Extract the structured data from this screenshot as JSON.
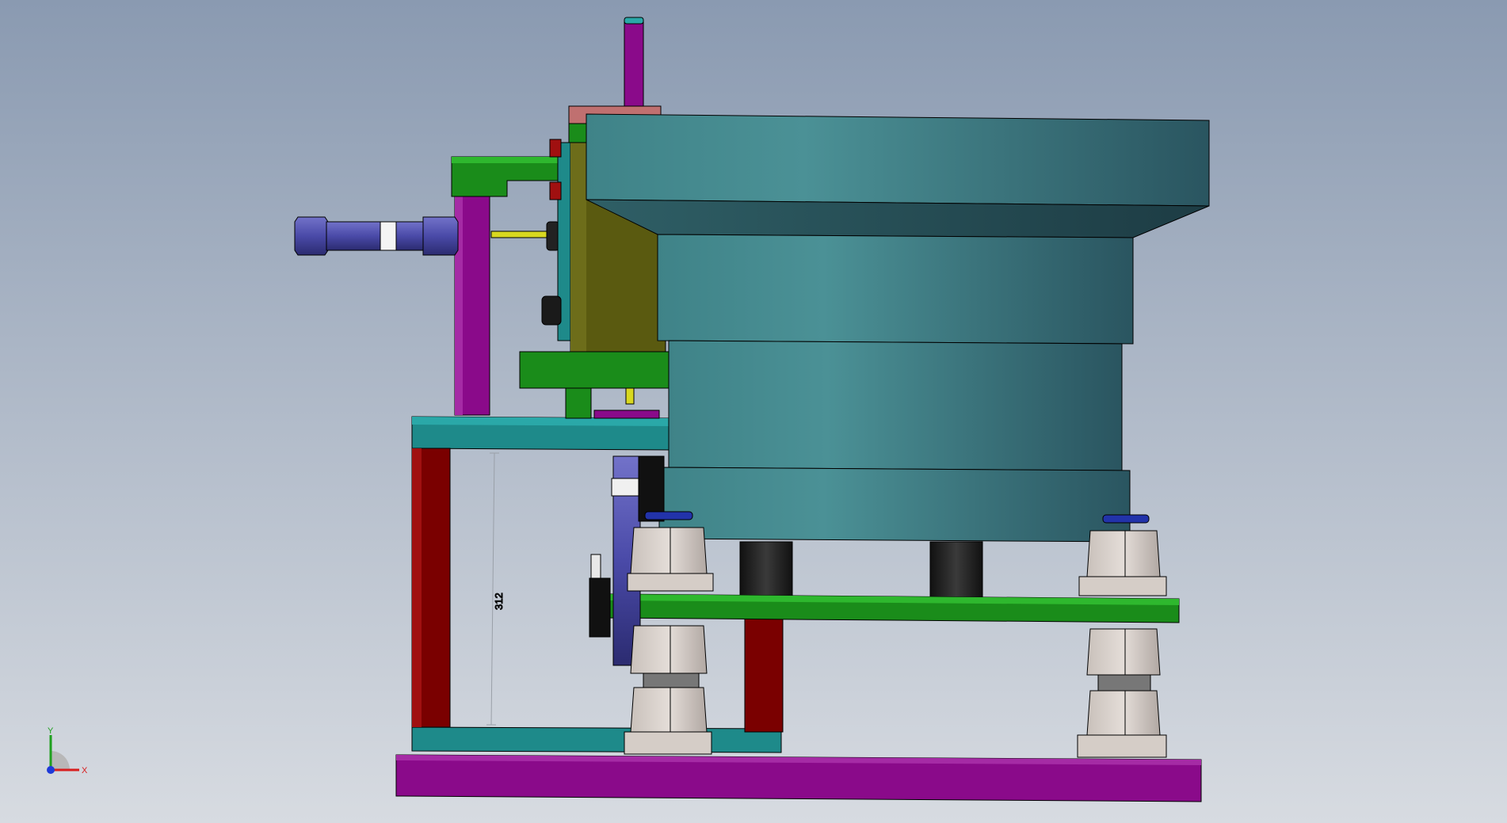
{
  "viewport": {
    "background_top": "#8a9ab1",
    "background_bottom": "#d7dbe1",
    "view_orientation": "front",
    "display_style": "shaded-with-edges"
  },
  "model": {
    "name": "",
    "dimension_label": "312",
    "part_colors": {
      "bowl_teal": "#3a7c80",
      "frame_purple": "#8a0a8a",
      "frame_red": "#7a0000",
      "bracket_green": "#1a8c1a",
      "plate_cyan": "#1e8a8a",
      "cylinder_blue": "#4a4aa8",
      "hex_nut": "#d7cfc9",
      "mount_olive": "#5a5a10",
      "pad_black": "#222222"
    }
  },
  "triad": {
    "x_label": "X",
    "y_label": "Y",
    "x_color": "#d81e1e",
    "y_color": "#1ea01e",
    "z_color": "#1e3ad8"
  }
}
